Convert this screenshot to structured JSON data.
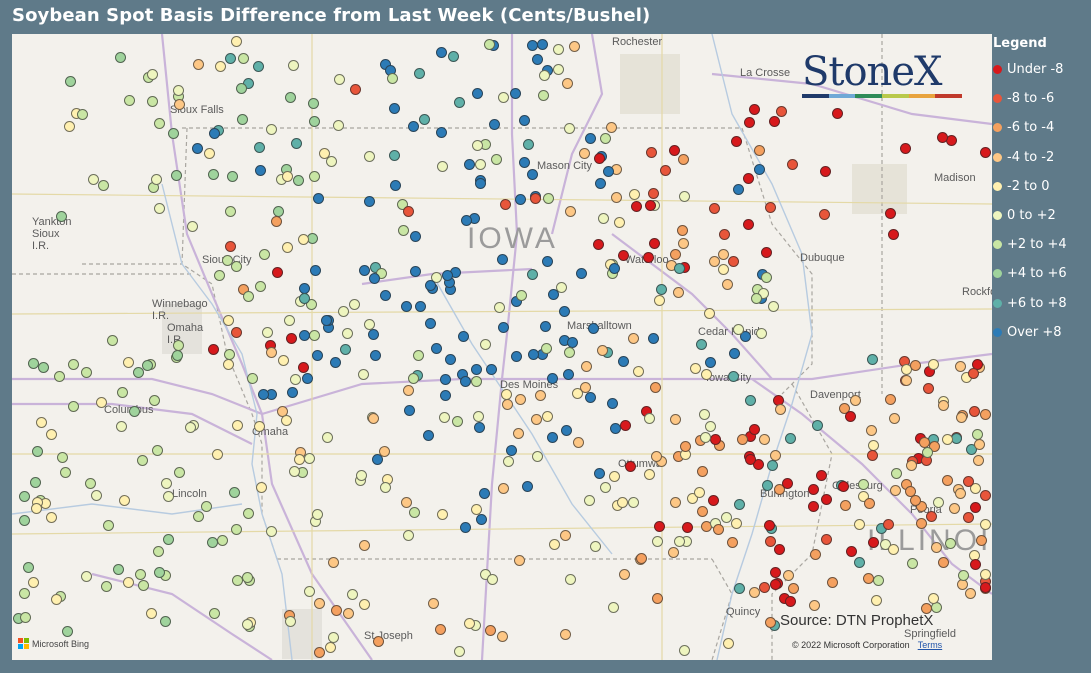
{
  "title": "Soybean Spot Basis Difference from Last Week (Cents/Bushel)",
  "legend": {
    "title": "Legend",
    "items": [
      {
        "label": "Under -8",
        "color": "#d7191c"
      },
      {
        "label": "-8 to -6",
        "color": "#e8553a"
      },
      {
        "label": "-6 to -4",
        "color": "#f4a05f"
      },
      {
        "label": "-4 to -2",
        "color": "#fdc785"
      },
      {
        "label": "-2 to 0",
        "color": "#fff0b0"
      },
      {
        "label": "0 to +2",
        "color": "#eef5bf"
      },
      {
        "label": "+2 to +4",
        "color": "#c9e6a4"
      },
      {
        "label": "+4 to +6",
        "color": "#9fd39c"
      },
      {
        "label": "+6 to +8",
        "color": "#5fb0a8"
      },
      {
        "label": "Over +8",
        "color": "#2c7bb6"
      }
    ]
  },
  "map": {
    "state_label_iowa": "IOWA",
    "state_label_illinois": "ILLINOIS",
    "places": {
      "rochester": "Rochester",
      "la_crosse": "La Crosse",
      "sioux_falls": "Sioux Falls",
      "mason_city": "Mason City",
      "madison": "Madison",
      "yankton_sioux": "Yankton Sioux I.R.",
      "sioux_city": "Sioux City",
      "waterloo": "Waterloo",
      "dubuque": "Dubuque",
      "rockford": "Rockford",
      "winnebago": "Winnebago I.R.",
      "omaha_ir": "Omaha I.R.",
      "marshalltown": "Marshalltown",
      "cedar_rapids": "Cedar Rapids",
      "iowa_city": "Iowa City",
      "davenport": "Davenport",
      "columbus": "Columbus",
      "des_moines": "Des Moines",
      "omaha": "Omaha",
      "ottumwa": "Ottumwa",
      "lincoln": "Lincoln",
      "burlington": "Burlington",
      "galesburg": "Galesburg",
      "peoria": "Peoria",
      "quincy": "Quincy",
      "st_joseph": "St Joseph",
      "springfield": "Springfield"
    },
    "source": "Source: DTN ProphetX",
    "copyright": "© 2022 Microsoft Corporation",
    "terms": "Terms",
    "bing": "Microsoft Bing"
  },
  "logo": {
    "text": "StoneX",
    "bar_colors": [
      "#1f3a6a",
      "#6fa8d6",
      "#2e8b57",
      "#b9c94b",
      "#e8a33d",
      "#c0392b"
    ]
  },
  "chart_data": {
    "type": "scatter",
    "description_of_values": "Each marker is a grain elevator location; color encodes the week-over-week soybean basis change bin (cents/bushel).",
    "bins": [
      "Under -8",
      "-8 to -6",
      "-6 to -4",
      "-4 to -2",
      "-2 to 0",
      "0 to +2",
      "+2 to +4",
      "+4 to +6",
      "+6 to +8",
      "Over +8"
    ],
    "regional_pattern": [
      {
        "region": "Central Iowa",
        "dominant_bin": "Over +8"
      },
      {
        "region": "Northeast Iowa / Southern Minnesota",
        "dominant_bin": "Under -8"
      },
      {
        "region": "Southeast Iowa / Western Illinois",
        "dominant_bin": "Under -8"
      },
      {
        "region": "Western Illinois",
        "dominant_bin": "-6 to -4"
      },
      {
        "region": "Eastern Nebraska",
        "dominant_bin": "+4 to +6"
      },
      {
        "region": "Western Iowa / Northwest Missouri",
        "dominant_bin": "0 to +2"
      }
    ]
  }
}
